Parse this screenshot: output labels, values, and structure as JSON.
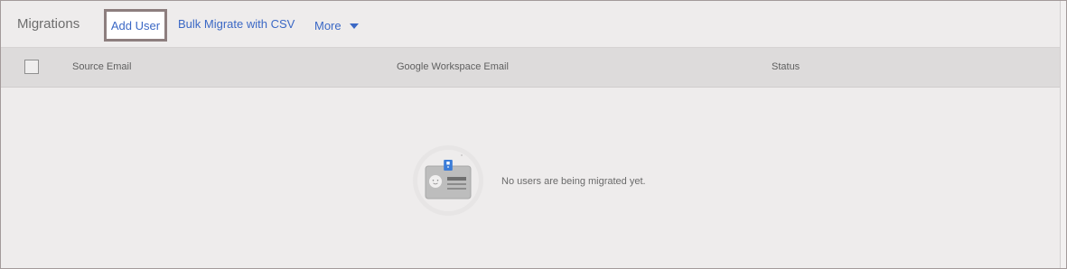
{
  "header": {
    "title": "Migrations",
    "add_user": "Add User",
    "bulk_migrate": "Bulk Migrate with CSV",
    "more": "More"
  },
  "table": {
    "columns": [
      "Source Email",
      "Google Workspace Email",
      "Status"
    ]
  },
  "empty_state": {
    "icon": "user-id-card-icon",
    "message": "No users are being migrated yet."
  },
  "colors": {
    "accent": "#3b68c5",
    "background": "#eeecec",
    "header_background": "#dddbdb",
    "highlight_border": "#8d7e7e"
  }
}
